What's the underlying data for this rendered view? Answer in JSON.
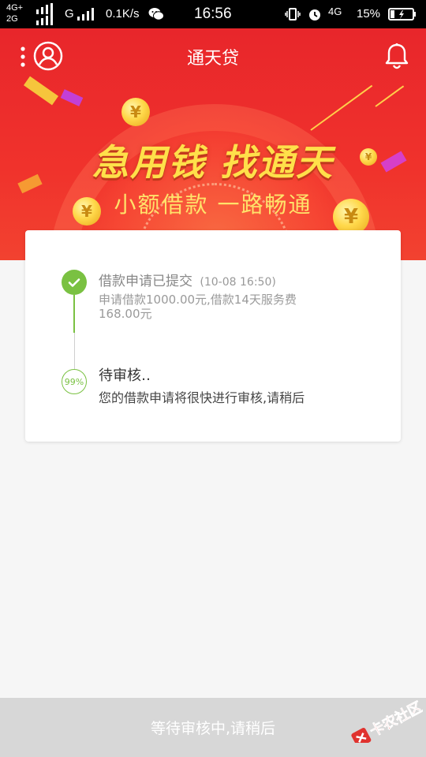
{
  "status_bar": {
    "network_top": "4G+",
    "network_bottom": "2G",
    "network_g": "G",
    "speed": "0.1K/s",
    "time": "16:56",
    "network_right": "4G",
    "battery": "15%"
  },
  "header": {
    "title": "通天贷"
  },
  "banner": {
    "slogan_main": "急用钱 找通天",
    "slogan_sub": "小额借款 一路畅通",
    "coin_symbol": "¥"
  },
  "progress": {
    "step1": {
      "title": "借款申请已提交",
      "time": "(10-08 16:50)",
      "description": "申请借款1000.00元,借款14天服务费168.00元"
    },
    "step2": {
      "percent_label": "99%",
      "title": "待审核‥",
      "description": "您的借款申请将很快进行审核,请稍后"
    }
  },
  "bottom": {
    "button_label": "等待审核中,请稍后"
  },
  "watermark": {
    "text": "卡农社区"
  },
  "colors": {
    "banner_red": "#e8262b",
    "success_green": "#7ac142",
    "slogan_yellow": "#ffe04a",
    "bottom_gray": "#d7d7d7"
  }
}
